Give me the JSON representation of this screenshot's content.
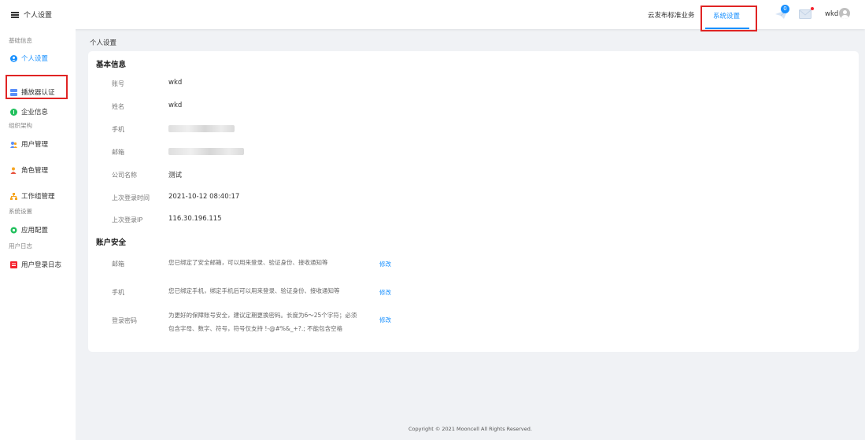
{
  "header": {
    "app_title": "个人设置",
    "nav_cloud": "云发布标准业务",
    "nav_active": "系统设置",
    "notification_count": "0",
    "user_name": "wkd",
    "accent_color": "#1890ff",
    "highlight_color": "#e02424"
  },
  "sidebar": {
    "groups": [
      "基础信息",
      "组织架构",
      "系统设置",
      "用户日志"
    ],
    "items": [
      {
        "label": "个人设置",
        "icon": "user-circle-icon"
      },
      {
        "label": "播放器认证",
        "icon": "player-icon"
      },
      {
        "label": "企业信息",
        "icon": "enterprise-icon"
      },
      {
        "label": "用户管理",
        "icon": "users-icon"
      },
      {
        "label": "角色管理",
        "icon": "role-icon"
      },
      {
        "label": "工作组管理",
        "icon": "workgroup-icon"
      },
      {
        "label": "应用配置",
        "icon": "app-config-icon"
      },
      {
        "label": "用户登录日志",
        "icon": "login-log-icon"
      }
    ]
  },
  "breadcrumb": "个人设置",
  "basic": {
    "title": "基本信息",
    "fields": [
      {
        "label": "账号",
        "value": "wkd"
      },
      {
        "label": "姓名",
        "value": "wkd"
      },
      {
        "label": "手机",
        "value": ""
      },
      {
        "label": "邮箱",
        "value": ""
      },
      {
        "label": "公司名称",
        "value": "测试"
      },
      {
        "label": "上次登录时间",
        "value": "2021-10-12 08:40:17"
      },
      {
        "label": "上次登录IP",
        "value": "116.30.196.115"
      }
    ]
  },
  "security": {
    "title": "账户安全",
    "rows": [
      {
        "label": "邮箱",
        "desc": "您已绑定了安全邮箱，可以用来登录、验证身份、接收通知等",
        "action": "修改"
      },
      {
        "label": "手机",
        "desc": "您已绑定手机，绑定手机后可以用来登录、验证身份、接收通知等",
        "action": "修改"
      },
      {
        "label": "登录密码",
        "desc_line1": "为更好的保障账号安全，建议定期更换密码。长度为6～25个字符；必须",
        "desc_line2": "包含字母、数字、符号，符号仅支持 !-@#%&_+?.;  不能包含空格",
        "action": "修改"
      }
    ]
  },
  "footer": "Copyright © 2021 Mooncell All Rights Reserved."
}
